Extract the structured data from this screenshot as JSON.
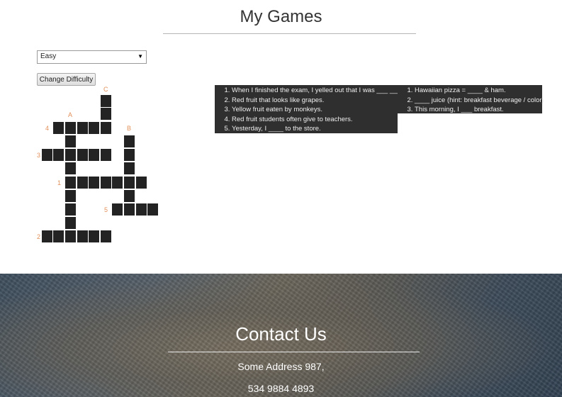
{
  "page": {
    "title": "My Games"
  },
  "difficulty": {
    "selected": "Easy",
    "change_label": "Change Difficulty"
  },
  "crossword": {
    "labels": {
      "c": "C",
      "a": "A",
      "b": "B",
      "n4": "4",
      "n3": "3",
      "n1": "1",
      "n5": "5",
      "n2": "2"
    }
  },
  "clues": {
    "across": [
      "When I finished the exam, I yelled out that I was ___ ___.",
      "Red fruit that looks like grapes.",
      "Yellow fruit eaten by monkeys.",
      "Red fruit students often give to teachers.",
      "Yesterday, I ____ to the store."
    ],
    "down": [
      "Hawaiian pizza = ____ & ham.",
      "____ juice (hint: breakfast beverage / color)",
      "This morning, I ___ breakfast."
    ]
  },
  "footer": {
    "title": "Contact Us",
    "address": "Some Address 987,",
    "phone": "534 9884 4893"
  }
}
